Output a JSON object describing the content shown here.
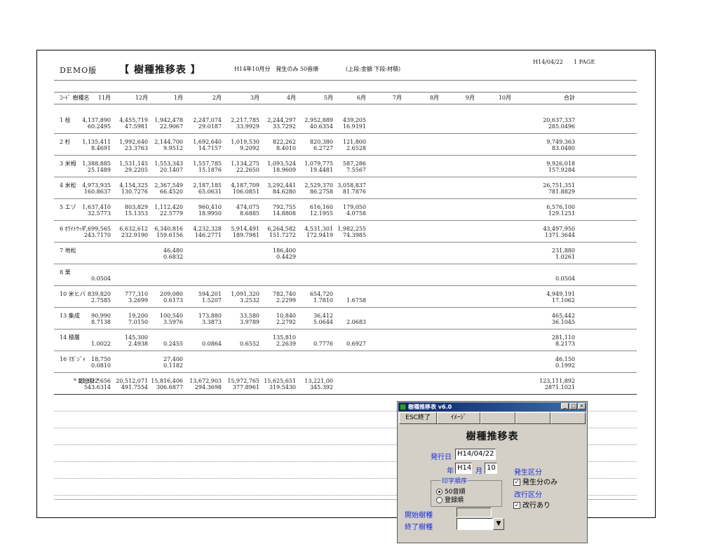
{
  "header": {
    "brand": "DEMO版",
    "title": "【 樹種推移表 】",
    "condition": "H14年10月分　発生のみ 50音順",
    "legend_note": "(上段:金額 下段:材積)",
    "date": "H14/04/22",
    "page": "1 PAGE"
  },
  "columns": [
    "ｺｰﾄﾞ 樹種名",
    "11月",
    "12月",
    "1月",
    "2月",
    "3月",
    "4月",
    "5月",
    "6月",
    "7月",
    "8月",
    "9月",
    "10月",
    "合計"
  ],
  "rows": [
    {
      "name": "1 桧",
      "amount": [
        "4,137,890",
        "4,455,719",
        "1,942,478",
        "2,247,074",
        "2,217,785",
        "2,244,297",
        "2,952,889",
        "439,205",
        "",
        "",
        "",
        "",
        "20,637,337"
      ],
      "volume": [
        "60.2495",
        "47.5981",
        "22.9067",
        "29.0187",
        "33.9929",
        "33.7292",
        "40.6354",
        "16.9191",
        "",
        "",
        "",
        "",
        "285.0496"
      ]
    },
    {
      "name": "2 杉",
      "amount": [
        "1,135,411",
        "1,992,640",
        "2,144,700",
        "1,692,640",
        "1,019,530",
        "822,262",
        "820,380",
        "121,800",
        "",
        "",
        "",
        "",
        "9,749,363"
      ],
      "volume": [
        "8.4691",
        "23.3763",
        "9.9512",
        "14.7157",
        "9.2092",
        "8.4010",
        "6.2727",
        "2.6528",
        "",
        "",
        "",
        "",
        "83.0480"
      ]
    },
    {
      "name": "3 米栂",
      "amount": [
        "1,388,885",
        "1,531,145",
        "1,553,343",
        "1,557,785",
        "1,134,275",
        "1,093,524",
        "1,079,775",
        "587,286",
        "",
        "",
        "",
        "",
        "9,926,018"
      ],
      "volume": [
        "25.1489",
        "29.2205",
        "20.1407",
        "15.1876",
        "22.2650",
        "18.9609",
        "19.4481",
        "7.5567",
        "",
        "",
        "",
        "",
        "157.9284"
      ]
    },
    {
      "name": "4 米松",
      "amount": [
        "4,973,935",
        "4,154,325",
        "2,367,549",
        "2,187,185",
        "4,187,709",
        "3,292,441",
        "2,529,370",
        "3,058,837",
        "",
        "",
        "",
        "",
        "26,751,351"
      ],
      "volume": [
        "160.8637",
        "130.7276",
        "66.4520",
        "65.0631",
        "106.0851",
        "84.6280",
        "86.2758",
        "81.7876",
        "",
        "",
        "",
        "",
        "781.8829"
      ]
    },
    {
      "name": "5 エゾ",
      "amount": [
        "1,637,410",
        "803,829",
        "1,112,420",
        "960,410",
        "474,075",
        "792,755",
        "616,160",
        "179,050",
        "",
        "",
        "",
        "",
        "6,576,100"
      ],
      "volume": [
        "32.5773",
        "15.1353",
        "22.5779",
        "18.9950",
        "8.6885",
        "14.8808",
        "12.1955",
        "4.0758",
        "",
        "",
        "",
        "",
        "129.1251"
      ]
    },
    {
      "name": "6 ﾎﾜｲﾄｳｯﾄﾞ",
      "amount": [
        "7,699,565",
        "6,632,612",
        "6,340,816",
        "4,232,328",
        "5,914,491",
        "6,264,582",
        "4,531,301",
        "1,982,255",
        "",
        "",
        "",
        "",
        "43,497,950"
      ],
      "volume": [
        "243.7170",
        "232.9190",
        "159.6156",
        "146.2771",
        "189.7981",
        "151.7272",
        "172.9419",
        "74.3985",
        "",
        "",
        "",
        "",
        "1371.3644"
      ]
    },
    {
      "name": "7 地松",
      "amount": [
        "",
        "",
        "46,480",
        "",
        "",
        "186,400",
        "",
        "",
        "",
        "",
        "",
        "",
        "231,880"
      ],
      "volume": [
        "",
        "",
        "0.6832",
        "",
        "",
        "0.4429",
        "",
        "",
        "",
        "",
        "",
        "",
        "1.0261"
      ]
    },
    {
      "name": "8 栗",
      "amount": [
        "",
        "",
        "",
        "",
        "",
        "",
        "",
        "",
        "",
        "",
        "",
        "",
        ""
      ],
      "volume": [
        "0.0504",
        "",
        "",
        "",
        "",
        "",
        "",
        "",
        "",
        "",
        "",
        "",
        "0.0504"
      ]
    },
    {
      "name": "10 米ヒバ",
      "amount": [
        "839,820",
        "777,310",
        "209,080",
        "594,201",
        "1,091,320",
        "782,740",
        "654,720",
        "",
        "",
        "",
        "",
        "",
        "4,949,191"
      ],
      "volume": [
        "2.7585",
        "3.2699",
        "0.6173",
        "1.5207",
        "3.2532",
        "2.2299",
        "1.7810",
        "1.6758",
        "",
        "",
        "",
        "",
        "17.1062"
      ]
    },
    {
      "name": "13 集成",
      "amount": [
        "90,990",
        "19,200",
        "100,540",
        "173,880",
        "33,580",
        "10,840",
        "36,412",
        "",
        "",
        "",
        "",
        "",
        "465,442"
      ],
      "volume": [
        "8.7138",
        "7.0150",
        "3.5976",
        "3.3873",
        "3.9789",
        "2.2792",
        "5.0644",
        "2.0683",
        "",
        "",
        "",
        "",
        "36.1045"
      ]
    },
    {
      "name": "14 積層",
      "amount": [
        "",
        "145,300",
        "",
        "",
        "",
        "135,810",
        "",
        "",
        "",
        "",
        "",
        "",
        "281,110"
      ],
      "volume": [
        "1.0022",
        "2.4938",
        "0.2455",
        "0.0864",
        "0.6552",
        "2.2639",
        "0.7776",
        "0.6927",
        "",
        "",
        "",
        "",
        "8.2173"
      ]
    },
    {
      "name": "16 ﾏｶﾞｼﾞｬ",
      "amount": [
        "18,750",
        "",
        "27,400",
        "",
        "",
        "",
        "",
        "",
        "",
        "",
        "",
        "",
        "46,150"
      ],
      "volume": [
        "0.0810",
        "",
        "0.1182",
        "",
        "",
        "",
        "",
        "",
        "",
        "",
        "",
        "",
        "0.1992"
      ]
    },
    {
      "name": "* 総合計 *",
      "amount": [
        "21,922,656",
        "20,512,071",
        "15,816,406",
        "13,672,903",
        "15,972,765",
        "15,625,651",
        "13,221,00",
        "",
        "",
        "",
        "",
        "",
        "123,111,892"
      ],
      "volume": [
        "543.6314",
        "491.7554",
        "306.6877",
        "294.3698",
        "377.8961",
        "319.5430",
        "345.392",
        "",
        "",
        "",
        "",
        "",
        "2871.1021"
      ]
    }
  ],
  "dialog": {
    "window_title": "樹種推移表 v6.0",
    "minimize": "_",
    "maximize": "□",
    "close": "×",
    "esc_button": "ESC終了",
    "image_button": "ｲﾒｰｼﾞ",
    "heading": "樹種推移表",
    "issue_date_label": "発行日",
    "issue_date_value": "H14/04/22",
    "year_label": "年",
    "year_value": "H14",
    "month_label": "月",
    "month_value": "10",
    "print_order_label": "印字順序",
    "order_options": [
      "50音順",
      "登録順"
    ],
    "occurrence_label": "発生区分",
    "occurrence_check": "発生分のみ",
    "linebreak_label": "改行区分",
    "linebreak_check": "改行あり",
    "start_species_label": "開始樹種",
    "end_species_label": "終了樹種",
    "dropdown_arrow": "▼",
    "check_mark": "✓",
    "colors": {
      "label_blue": "#1a2fd6",
      "titlebar": "#0a246a",
      "face": "#d4d0c8"
    }
  }
}
